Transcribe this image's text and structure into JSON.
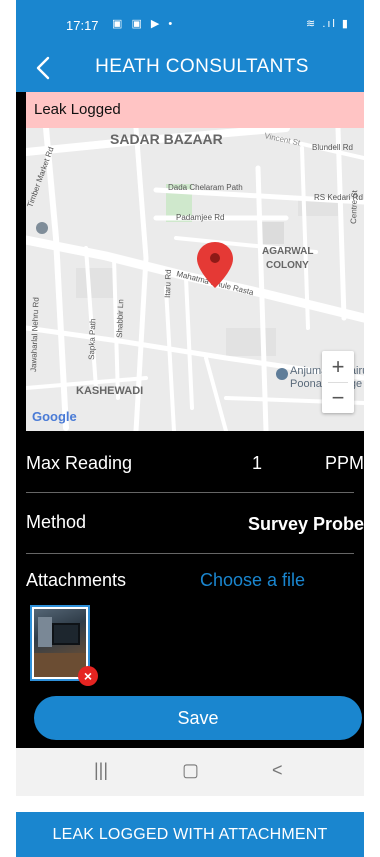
{
  "status_bar": {
    "time": "17:17",
    "left_icons": "▣ ▣ ▶ •",
    "right_icons": "≋ .ıl ▮"
  },
  "app_bar": {
    "title": "HEATH CONSULTANTS",
    "back_icon": "chevron-left-icon"
  },
  "banner": {
    "text": "Leak Logged",
    "color": "#ffc4c4"
  },
  "map": {
    "labels": {
      "sadar_bazaar": "SADAR BAZAAR",
      "vincent_st": "Vincent St",
      "blundell_rd": "Blundell Rd",
      "dada_chelaram": "Dada Chelaram Path",
      "rs_kedari": "RS Kedari Rd",
      "padamjee": "Padamjee Rd",
      "agarwal": "AGARWAL",
      "colony": "COLONY",
      "mahatma": "Mahatma Phule Rasta",
      "timber": "Timber Market Rd",
      "centre": "Centre St",
      "jawaharlal": "Jawaharlal Nehru Rd",
      "sapka": "Sapka Path",
      "shabbir": "Shabbir Ln",
      "itaru": "Itaru Rd",
      "anjuman1": "Anjuman Khairul Isl",
      "anjuman2": "Poona College of A",
      "kashewadi": "KASHEWADI",
      "google": "Google"
    },
    "zoom_in": "+",
    "zoom_out": "−",
    "pin_color": "#e53935"
  },
  "fields": {
    "max_reading": {
      "label": "Max Reading",
      "value": "1",
      "unit": "PPM"
    },
    "method": {
      "label": "Method",
      "value": "Survey Probe"
    },
    "attachments": {
      "label": "Attachments",
      "choose": "Choose a file"
    }
  },
  "attachment": {
    "remove_glyph": "×"
  },
  "save_button": {
    "label": "Save"
  },
  "nav_bar": {
    "recents": "|||",
    "home": "▢",
    "back": "<"
  },
  "caption": {
    "text": "LEAK LOGGED WITH ATTACHMENT"
  },
  "colors": {
    "accent": "#1a86cf",
    "background": "#000000",
    "danger": "#e52421"
  }
}
